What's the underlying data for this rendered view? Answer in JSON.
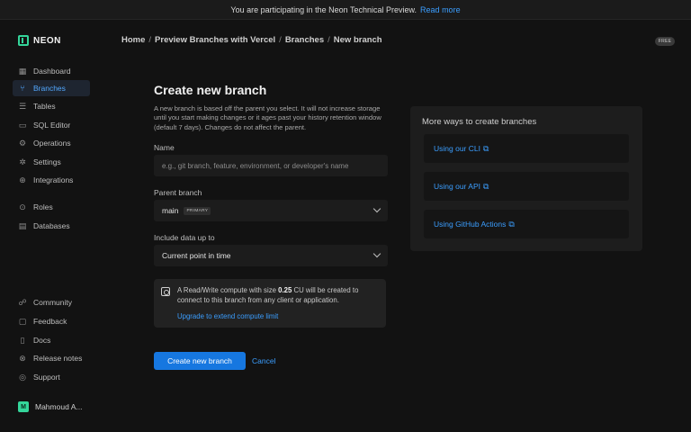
{
  "banner": {
    "text": "You are participating in the Neon Technical Preview.",
    "link": "Read more"
  },
  "brand": {
    "name": "NEON",
    "accent": "#34d59a"
  },
  "sidebar": {
    "main_items": [
      {
        "label": "Dashboard",
        "icon": "grid-icon"
      },
      {
        "label": "Branches",
        "icon": "branch-icon",
        "active": true
      },
      {
        "label": "Tables",
        "icon": "table-icon"
      },
      {
        "label": "SQL Editor",
        "icon": "editor-icon"
      },
      {
        "label": "Operations",
        "icon": "operations-icon"
      },
      {
        "label": "Settings",
        "icon": "gear-icon"
      },
      {
        "label": "Integrations",
        "icon": "integrations-icon"
      },
      {
        "label": "Roles",
        "icon": "roles-icon"
      },
      {
        "label": "Databases",
        "icon": "database-icon"
      }
    ],
    "footer_items": [
      {
        "label": "Community",
        "icon": "community-icon"
      },
      {
        "label": "Feedback",
        "icon": "feedback-icon"
      },
      {
        "label": "Docs",
        "icon": "docs-icon"
      },
      {
        "label": "Release notes",
        "icon": "release-notes-icon"
      },
      {
        "label": "Support",
        "icon": "support-icon"
      }
    ],
    "user": {
      "initial": "M",
      "name": "Mahmoud A..."
    }
  },
  "breadcrumb": [
    "Home",
    "Preview Branches with Vercel",
    "Branches",
    "New branch"
  ],
  "plan_badge": "FREE",
  "form": {
    "title": "Create new branch",
    "description": "A new branch is based off the parent you select. It will not increase storage until you start making changes or it ages past your history retention window (default 7 days). Changes do not affect the parent.",
    "name_label": "Name",
    "name_placeholder": "e.g., git branch, feature, environment, or developer's name",
    "parent_label": "Parent branch",
    "parent_value": "main",
    "parent_tag": "PRIMARY",
    "data_label": "Include data up to",
    "data_value": "Current point in time",
    "notice": {
      "text_before": "A Read/Write compute with size",
      "size": "0.25",
      "text_after": "CU will be created to connect to this branch from any client or application.",
      "link": "Upgrade to extend compute limit"
    },
    "submit_label": "Create new branch",
    "cancel_label": "Cancel"
  },
  "side_panel": {
    "title": "More ways to create branches",
    "items": [
      "Using our CLI",
      "Using our API",
      "Using GitHub Actions"
    ]
  }
}
